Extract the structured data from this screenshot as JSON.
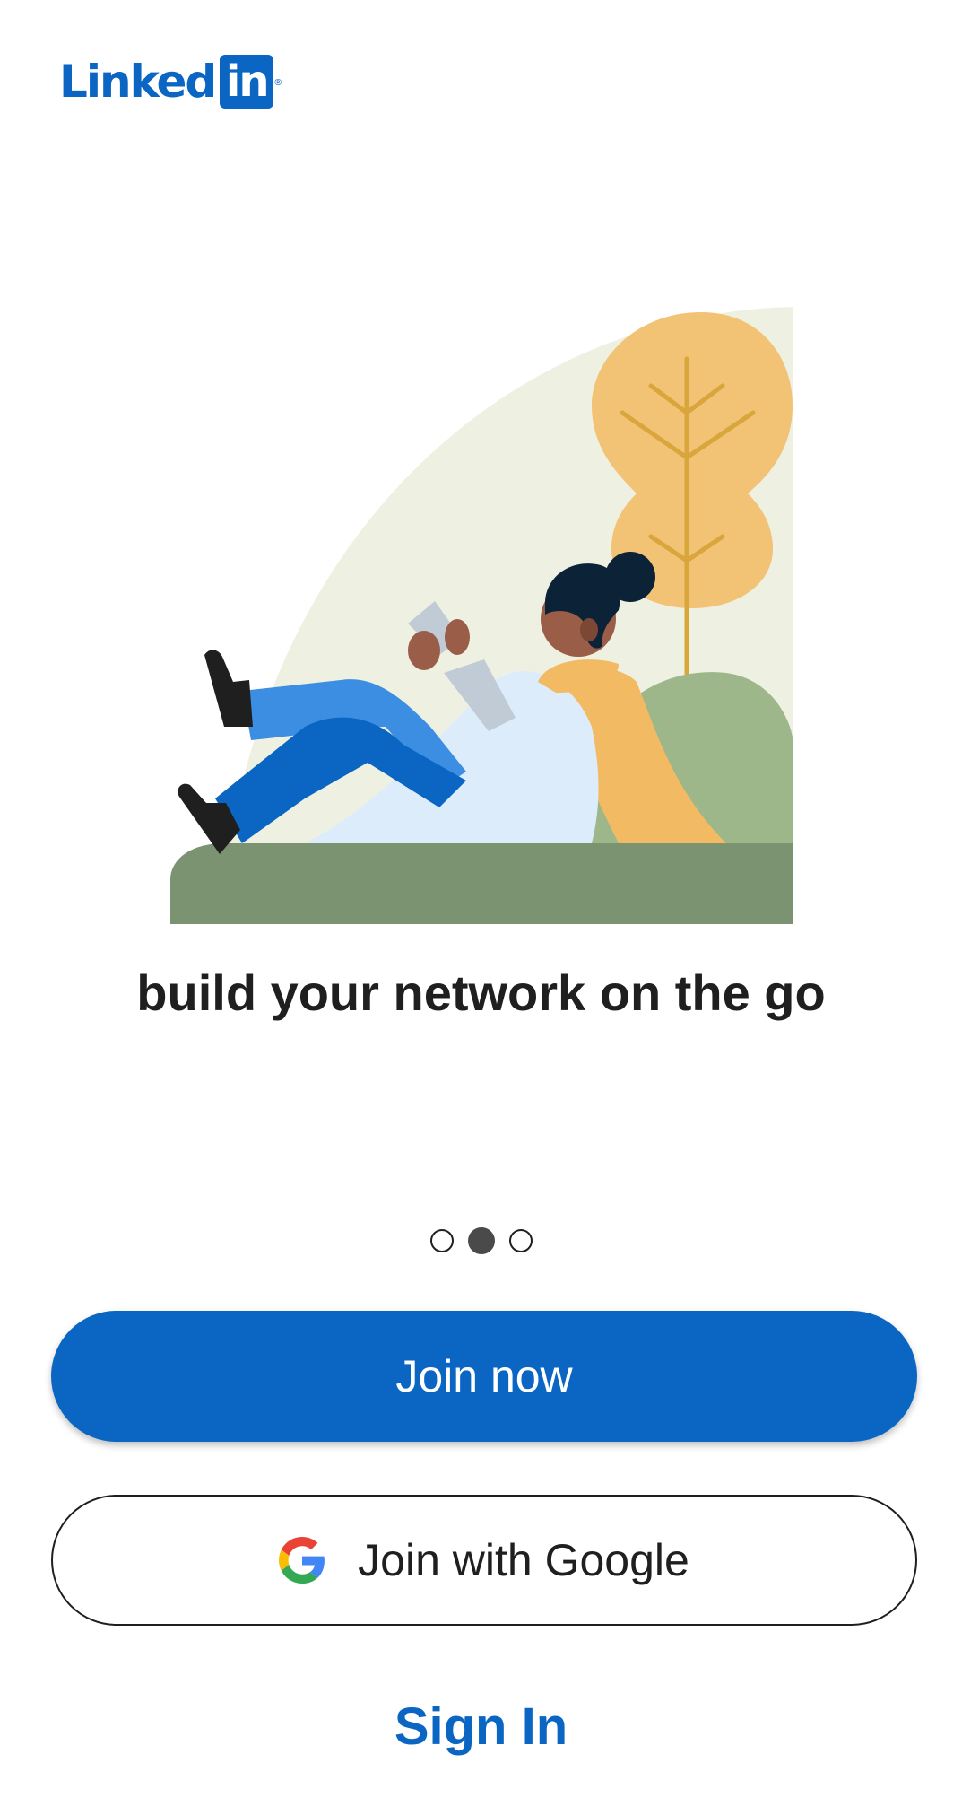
{
  "app": {
    "logo_word": "Linked",
    "logo_box": "in",
    "logo_registered": "®",
    "brand_color": "#0a66c2"
  },
  "onboarding": {
    "illustration": "person-reclining-reading-phone-illustration",
    "tagline": "build your network on the go",
    "carousel": {
      "page_count": 3,
      "active_page": 2
    }
  },
  "actions": {
    "join_now_label": "Join now",
    "join_google_label": "Join with Google",
    "google_icon": "google-g-icon",
    "sign_in_label": "Sign In"
  }
}
